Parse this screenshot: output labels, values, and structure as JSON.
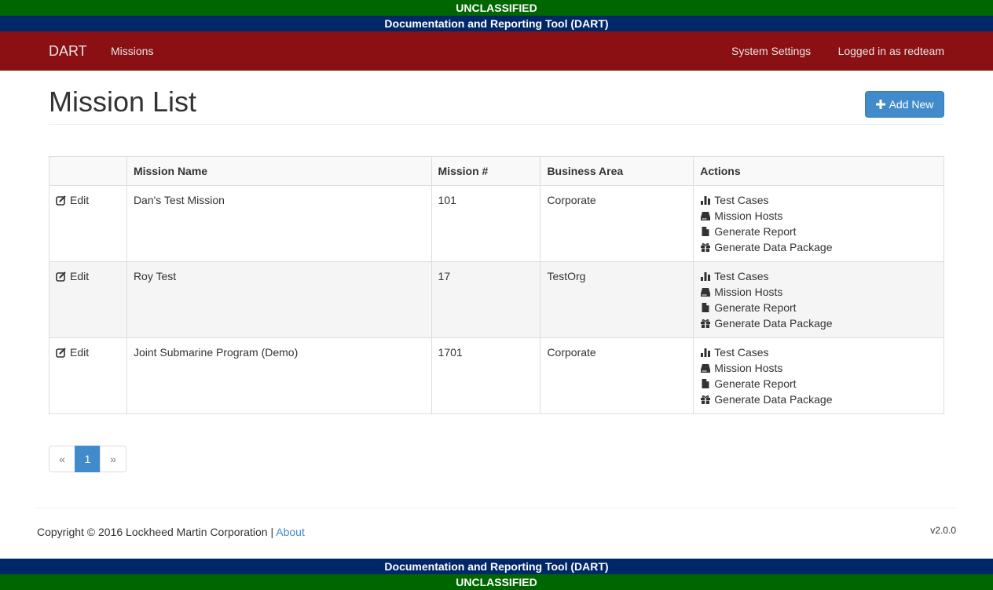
{
  "banners": {
    "classification": "UNCLASSIFIED",
    "app_full_name": "Documentation and Reporting Tool (DART)"
  },
  "navbar": {
    "brand": "DART",
    "missions": "Missions",
    "system_settings": "System Settings",
    "user": "Logged in as redteam"
  },
  "page": {
    "title": "Mission List",
    "add_button": "Add New"
  },
  "table": {
    "headers": [
      "",
      "Mission Name",
      "Mission #",
      "Business Area",
      "Actions"
    ],
    "edit_label": "Edit",
    "rows": [
      {
        "name": "Dan's Test Mission",
        "number": "101",
        "area": "Corporate"
      },
      {
        "name": "Roy Test",
        "number": "17",
        "area": "TestOrg"
      },
      {
        "name": "Joint Submarine Program (Demo)",
        "number": "1701",
        "area": "Corporate"
      }
    ],
    "actions": {
      "test_cases": "Test Cases",
      "mission_hosts": "Mission Hosts",
      "generate_report": "Generate Report",
      "generate_data_package": "Generate Data Package"
    }
  },
  "pagination": {
    "prev": "«",
    "current": "1",
    "next": "»"
  },
  "footer": {
    "copyright": "Copyright © 2016 Lockheed Martin Corporation |",
    "about": "About",
    "version": "v2.0.0"
  },
  "colors": {
    "classification_banner": "#006600",
    "name_banner": "#002868",
    "navbar": "#8b1014",
    "primary": "#428bca"
  }
}
